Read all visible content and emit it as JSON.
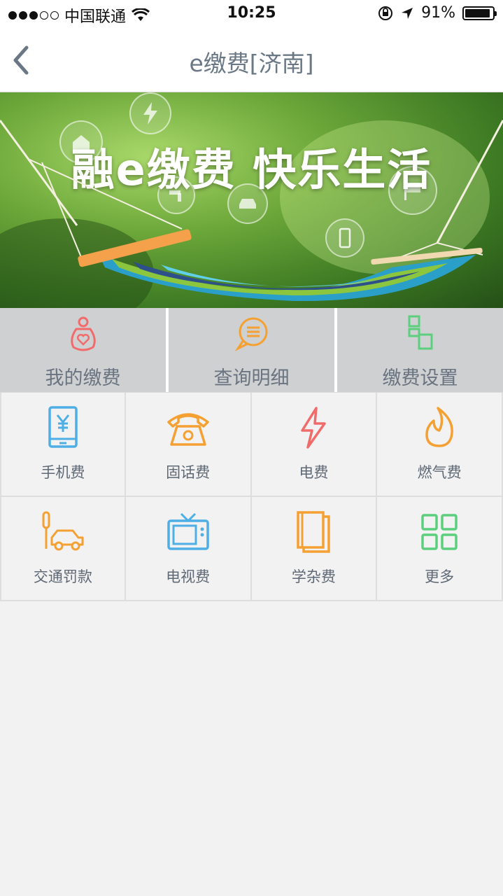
{
  "status_bar": {
    "carrier": "中国联通",
    "time": "10:25",
    "battery_percent": "91%",
    "battery_level": 0.91,
    "signal_bars_filled": 3,
    "signal_bars_total": 5
  },
  "nav": {
    "title": "e缴费[济南]"
  },
  "banner": {
    "slogan": "融e缴费  快乐生活"
  },
  "tabs": [
    {
      "label": "我的缴费",
      "icon": "heart-person-icon",
      "color": "#f26b6b"
    },
    {
      "label": "查询明细",
      "icon": "chat-list-icon",
      "color": "#f5a033"
    },
    {
      "label": "缴费设置",
      "icon": "settings-blocks-icon",
      "color": "#5ccf7e"
    }
  ],
  "services": [
    {
      "label": "手机费",
      "icon": "mobile-yen-icon",
      "color": "#4eaee6"
    },
    {
      "label": "固话费",
      "icon": "telephone-icon",
      "color": "#f5a033"
    },
    {
      "label": "电费",
      "icon": "lightning-icon",
      "color": "#f26b6b"
    },
    {
      "label": "燃气费",
      "icon": "flame-icon",
      "color": "#f5a033"
    },
    {
      "label": "交通罚款",
      "icon": "traffic-car-icon",
      "color": "#f5a033"
    },
    {
      "label": "电视费",
      "icon": "tv-icon",
      "color": "#4eaee6"
    },
    {
      "label": "学杂费",
      "icon": "books-icon",
      "color": "#f5a033"
    },
    {
      "label": "更多",
      "icon": "grid-more-icon",
      "color": "#5ccf7e"
    }
  ]
}
